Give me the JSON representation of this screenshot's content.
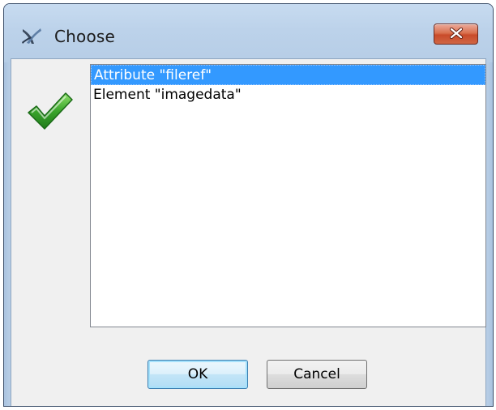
{
  "window": {
    "title": "Choose",
    "app_icon": "oxygen-cross-icon",
    "close_icon": "close-x-icon"
  },
  "dialog": {
    "status_icon": "green-checkmark-icon",
    "list_items": [
      {
        "label": "Attribute \"fileref\"",
        "selected": true
      },
      {
        "label": "Element \"imagedata\"",
        "selected": false
      }
    ],
    "ok_label": "OK",
    "cancel_label": "Cancel"
  },
  "colors": {
    "selection": "#3399ff",
    "close_button": "#c94b2a",
    "check": "#3aa52c"
  }
}
